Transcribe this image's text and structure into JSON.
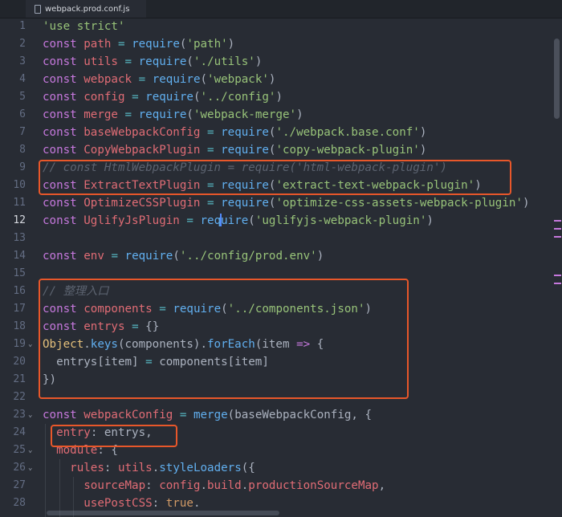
{
  "tab": {
    "filename": "webpack.prod.conf.js"
  },
  "lines": [
    {
      "n": "1",
      "tokens": [
        [
          "s",
          "'use strict'"
        ]
      ]
    },
    {
      "n": "2",
      "tokens": [
        [
          "k",
          "const"
        ],
        [
          "p",
          " "
        ],
        [
          "v",
          "path"
        ],
        [
          "p",
          " "
        ],
        [
          "o",
          "="
        ],
        [
          "p",
          " "
        ],
        [
          "f",
          "require"
        ],
        [
          "p",
          "("
        ],
        [
          "s",
          "'path'"
        ],
        [
          "p",
          ")"
        ]
      ]
    },
    {
      "n": "3",
      "tokens": [
        [
          "k",
          "const"
        ],
        [
          "p",
          " "
        ],
        [
          "v",
          "utils"
        ],
        [
          "p",
          " "
        ],
        [
          "o",
          "="
        ],
        [
          "p",
          " "
        ],
        [
          "f",
          "require"
        ],
        [
          "p",
          "("
        ],
        [
          "s",
          "'./utils'"
        ],
        [
          "p",
          ")"
        ]
      ]
    },
    {
      "n": "4",
      "tokens": [
        [
          "k",
          "const"
        ],
        [
          "p",
          " "
        ],
        [
          "v",
          "webpack"
        ],
        [
          "p",
          " "
        ],
        [
          "o",
          "="
        ],
        [
          "p",
          " "
        ],
        [
          "f",
          "require"
        ],
        [
          "p",
          "("
        ],
        [
          "s",
          "'webpack'"
        ],
        [
          "p",
          ")"
        ]
      ]
    },
    {
      "n": "5",
      "tokens": [
        [
          "k",
          "const"
        ],
        [
          "p",
          " "
        ],
        [
          "v",
          "config"
        ],
        [
          "p",
          " "
        ],
        [
          "o",
          "="
        ],
        [
          "p",
          " "
        ],
        [
          "f",
          "require"
        ],
        [
          "p",
          "("
        ],
        [
          "s",
          "'../config'"
        ],
        [
          "p",
          ")"
        ]
      ]
    },
    {
      "n": "6",
      "tokens": [
        [
          "k",
          "const"
        ],
        [
          "p",
          " "
        ],
        [
          "v",
          "merge"
        ],
        [
          "p",
          " "
        ],
        [
          "o",
          "="
        ],
        [
          "p",
          " "
        ],
        [
          "f",
          "require"
        ],
        [
          "p",
          "("
        ],
        [
          "s",
          "'webpack-merge'"
        ],
        [
          "p",
          ")"
        ]
      ]
    },
    {
      "n": "7",
      "tokens": [
        [
          "k",
          "const"
        ],
        [
          "p",
          " "
        ],
        [
          "v",
          "baseWebpackConfig"
        ],
        [
          "p",
          " "
        ],
        [
          "o",
          "="
        ],
        [
          "p",
          " "
        ],
        [
          "f",
          "require"
        ],
        [
          "p",
          "("
        ],
        [
          "s",
          "'./webpack.base.conf'"
        ],
        [
          "p",
          ")"
        ]
      ]
    },
    {
      "n": "8",
      "tokens": [
        [
          "k",
          "const"
        ],
        [
          "p",
          " "
        ],
        [
          "v",
          "CopyWebpackPlugin"
        ],
        [
          "p",
          " "
        ],
        [
          "o",
          "="
        ],
        [
          "p",
          " "
        ],
        [
          "f",
          "require"
        ],
        [
          "p",
          "("
        ],
        [
          "s",
          "'copy-webpack-plugin'"
        ],
        [
          "p",
          ")"
        ]
      ]
    },
    {
      "n": "9",
      "tokens": [
        [
          "c",
          "// const HtmlWebpackPlugin = require('html-webpack-plugin')"
        ]
      ]
    },
    {
      "n": "10",
      "tokens": [
        [
          "k",
          "const"
        ],
        [
          "p",
          " "
        ],
        [
          "v",
          "ExtractTextPlugin"
        ],
        [
          "p",
          " "
        ],
        [
          "o",
          "="
        ],
        [
          "p",
          " "
        ],
        [
          "f",
          "require"
        ],
        [
          "p",
          "("
        ],
        [
          "s",
          "'extract-text-webpack-plugin'"
        ],
        [
          "p",
          ")"
        ]
      ]
    },
    {
      "n": "11",
      "tokens": [
        [
          "k",
          "const"
        ],
        [
          "p",
          " "
        ],
        [
          "v",
          "OptimizeCSSPlugin"
        ],
        [
          "p",
          " "
        ],
        [
          "o",
          "="
        ],
        [
          "p",
          " "
        ],
        [
          "f",
          "require"
        ],
        [
          "p",
          "("
        ],
        [
          "s",
          "'optimize-css-assets-webpack-plugin'"
        ],
        [
          "p",
          ")"
        ]
      ]
    },
    {
      "n": "12",
      "active": true,
      "tokens": [
        [
          "k",
          "const"
        ],
        [
          "p",
          " "
        ],
        [
          "v",
          "UglifyJsPlugin"
        ],
        [
          "p",
          " "
        ],
        [
          "o",
          "="
        ],
        [
          "p",
          " "
        ],
        [
          "f",
          "req"
        ],
        [
          "cursor",
          ""
        ],
        [
          "f",
          "uire"
        ],
        [
          "p",
          "("
        ],
        [
          "s",
          "'uglifyjs-webpack-plugin'"
        ],
        [
          "p",
          ")"
        ]
      ]
    },
    {
      "n": "13",
      "tokens": []
    },
    {
      "n": "14",
      "tokens": [
        [
          "k",
          "const"
        ],
        [
          "p",
          " "
        ],
        [
          "v",
          "env"
        ],
        [
          "p",
          " "
        ],
        [
          "o",
          "="
        ],
        [
          "p",
          " "
        ],
        [
          "f",
          "require"
        ],
        [
          "p",
          "("
        ],
        [
          "s",
          "'../config/prod.env'"
        ],
        [
          "p",
          ")"
        ]
      ]
    },
    {
      "n": "15",
      "tokens": []
    },
    {
      "n": "16",
      "tokens": [
        [
          "c",
          "// 整理入口"
        ]
      ]
    },
    {
      "n": "17",
      "tokens": [
        [
          "k",
          "const"
        ],
        [
          "p",
          " "
        ],
        [
          "v",
          "components"
        ],
        [
          "p",
          " "
        ],
        [
          "o",
          "="
        ],
        [
          "p",
          " "
        ],
        [
          "f",
          "require"
        ],
        [
          "p",
          "("
        ],
        [
          "s",
          "'../components.json'"
        ],
        [
          "p",
          ")"
        ]
      ]
    },
    {
      "n": "18",
      "tokens": [
        [
          "k",
          "const"
        ],
        [
          "p",
          " "
        ],
        [
          "v",
          "entrys"
        ],
        [
          "p",
          " "
        ],
        [
          "o",
          "="
        ],
        [
          "p",
          " {}"
        ]
      ]
    },
    {
      "n": "19",
      "fold": true,
      "tokens": [
        [
          "y",
          "Object"
        ],
        [
          "p",
          "."
        ],
        [
          "f",
          "keys"
        ],
        [
          "p",
          "(components)."
        ],
        [
          "f",
          "forEach"
        ],
        [
          "p",
          "(item "
        ],
        [
          "k",
          "=>"
        ],
        [
          "p",
          " {"
        ]
      ]
    },
    {
      "n": "20",
      "tokens": [
        [
          "p",
          "  entrys[item] "
        ],
        [
          "o",
          "="
        ],
        [
          "p",
          " components[item]"
        ]
      ]
    },
    {
      "n": "21",
      "tokens": [
        [
          "p",
          "})"
        ]
      ]
    },
    {
      "n": "22",
      "tokens": []
    },
    {
      "n": "23",
      "fold": true,
      "tokens": [
        [
          "k",
          "const"
        ],
        [
          "p",
          " "
        ],
        [
          "v",
          "webpackConfig"
        ],
        [
          "p",
          " "
        ],
        [
          "o",
          "="
        ],
        [
          "p",
          " "
        ],
        [
          "f",
          "merge"
        ],
        [
          "p",
          "(baseWebpackConfig, {"
        ]
      ]
    },
    {
      "n": "24",
      "tokens": [
        [
          "p",
          "  "
        ],
        [
          "v",
          "entry"
        ],
        [
          "p",
          ": entrys,"
        ]
      ]
    },
    {
      "n": "25",
      "fold": true,
      "tokens": [
        [
          "p",
          "  "
        ],
        [
          "v",
          "module"
        ],
        [
          "p",
          ": {"
        ]
      ]
    },
    {
      "n": "26",
      "fold": true,
      "tokens": [
        [
          "p",
          "    "
        ],
        [
          "v",
          "rules"
        ],
        [
          "p",
          ": "
        ],
        [
          "v",
          "utils"
        ],
        [
          "p",
          "."
        ],
        [
          "f",
          "styleLoaders"
        ],
        [
          "p",
          "({"
        ]
      ]
    },
    {
      "n": "27",
      "tokens": [
        [
          "p",
          "      "
        ],
        [
          "v",
          "sourceMap"
        ],
        [
          "p",
          ": "
        ],
        [
          "v",
          "config"
        ],
        [
          "p",
          "."
        ],
        [
          "v",
          "build"
        ],
        [
          "p",
          "."
        ],
        [
          "v",
          "productionSourceMap"
        ],
        [
          "p",
          ","
        ]
      ]
    },
    {
      "n": "28",
      "tokens": [
        [
          "p",
          "      "
        ],
        [
          "v",
          "usePostCSS"
        ],
        [
          "p",
          ": "
        ],
        [
          "n",
          "true"
        ],
        [
          "p",
          "."
        ]
      ]
    }
  ],
  "colors": {
    "background": "#282c34",
    "highlight_box": "#e8572a",
    "cursor": "#528bff"
  }
}
